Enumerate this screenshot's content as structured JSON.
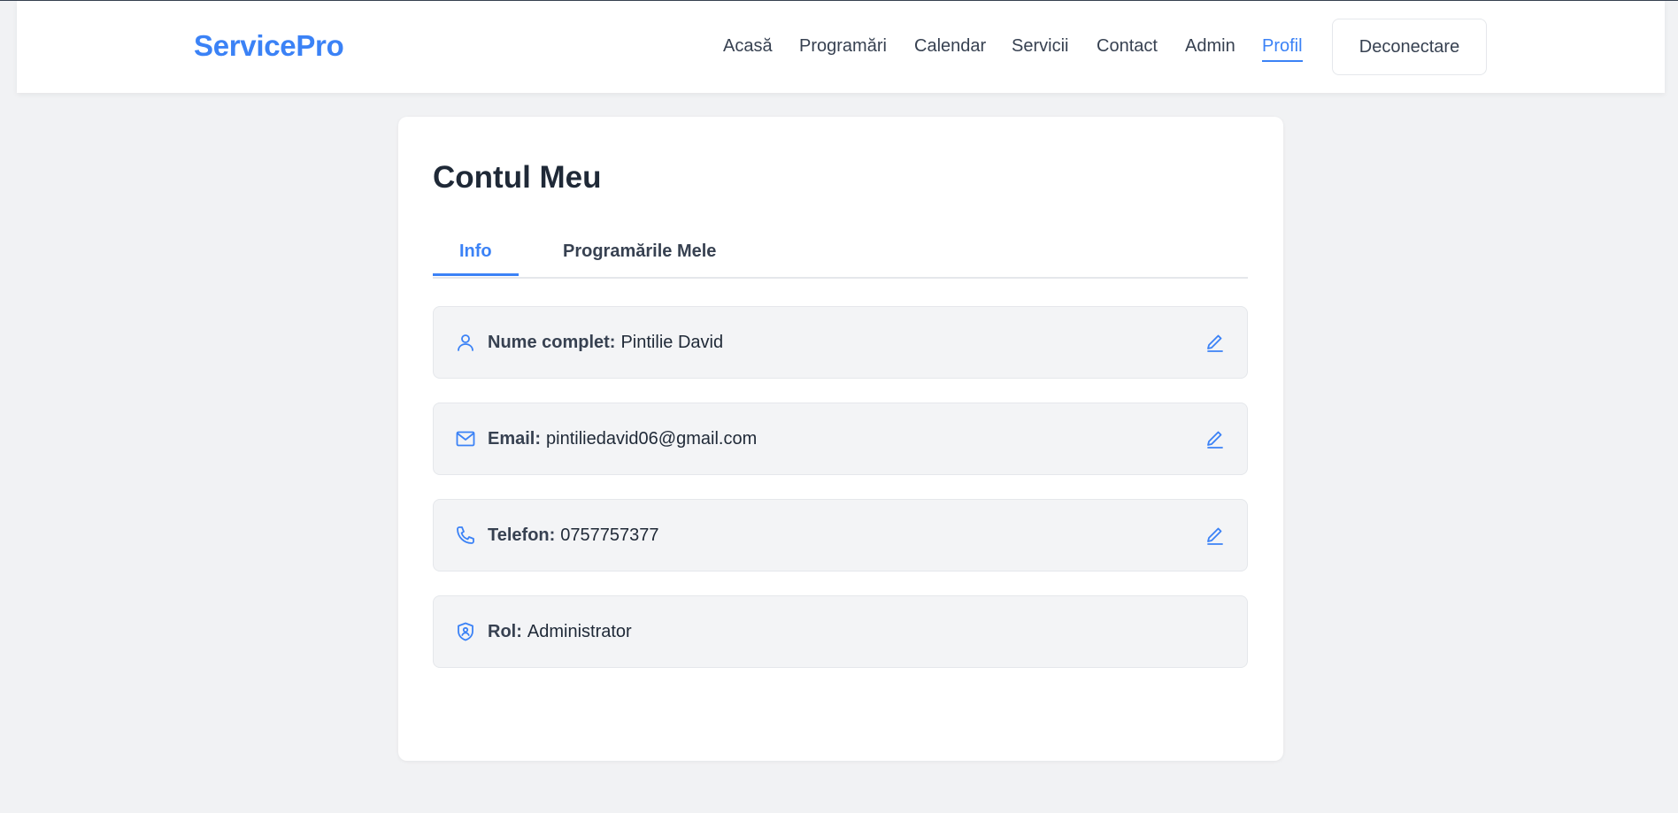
{
  "brand": "ServicePro",
  "nav": {
    "links": [
      "Acasă",
      "Programări",
      "Calendar",
      "Servicii",
      "Contact",
      "Admin",
      "Profil"
    ],
    "active": "Profil",
    "logout_label": "Deconectare"
  },
  "page": {
    "title": "Contul Meu",
    "tabs": [
      "Info",
      "Programările Mele"
    ],
    "active_tab": "Info"
  },
  "profile": {
    "name": {
      "icon": "user-icon",
      "label": "Nume complet:",
      "value": "Pintilie David",
      "editable": true
    },
    "email": {
      "icon": "mail-icon",
      "label": "Email:",
      "value": "pintiliedavid06@gmail.com",
      "editable": true
    },
    "phone": {
      "icon": "phone-icon",
      "label": "Telefon:",
      "value": "0757757377",
      "editable": true
    },
    "role": {
      "icon": "shield-user-icon",
      "label": "Rol:",
      "value": "Administrator",
      "editable": false
    }
  },
  "colors": {
    "accent": "#3b82f6",
    "background": "#f1f2f4",
    "row_background": "#f3f4f6",
    "text": "#1f2937"
  }
}
